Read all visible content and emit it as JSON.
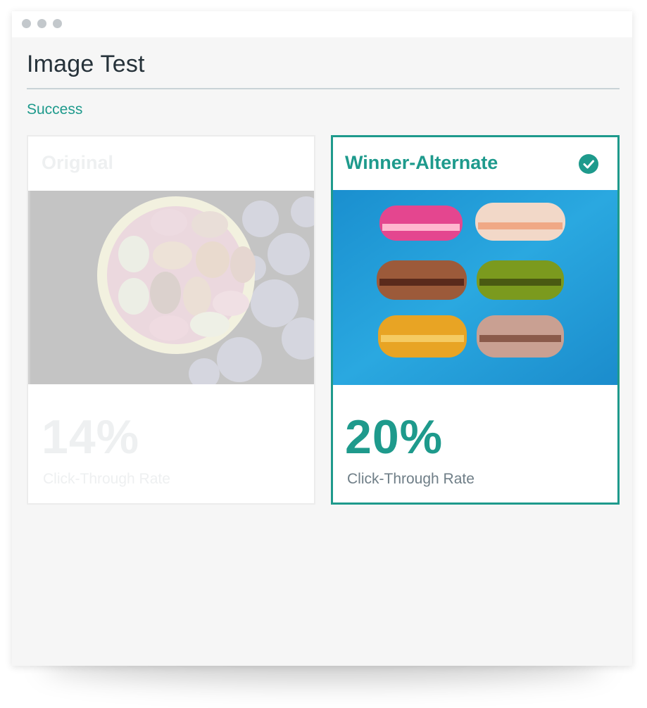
{
  "window": {
    "controls": [
      "close",
      "minimize",
      "maximize"
    ]
  },
  "page": {
    "title": "Image Test",
    "status": "Success"
  },
  "variants": [
    {
      "name": "Original",
      "image": "macarons-in-bowl-photo",
      "rate": "14%",
      "metric_label": "Click-Through Rate",
      "winner": false
    },
    {
      "name": "Winner-Alternate",
      "image": "stacked-macarons-photo",
      "rate": "20%",
      "metric_label": "Click-Through Rate",
      "winner": true,
      "badge_icon": "check-circle-icon"
    }
  ],
  "colors": {
    "accent": "#1e9a8c",
    "title": "#26323a",
    "muted": "#6f7e87",
    "faded": "#eef0f1"
  }
}
